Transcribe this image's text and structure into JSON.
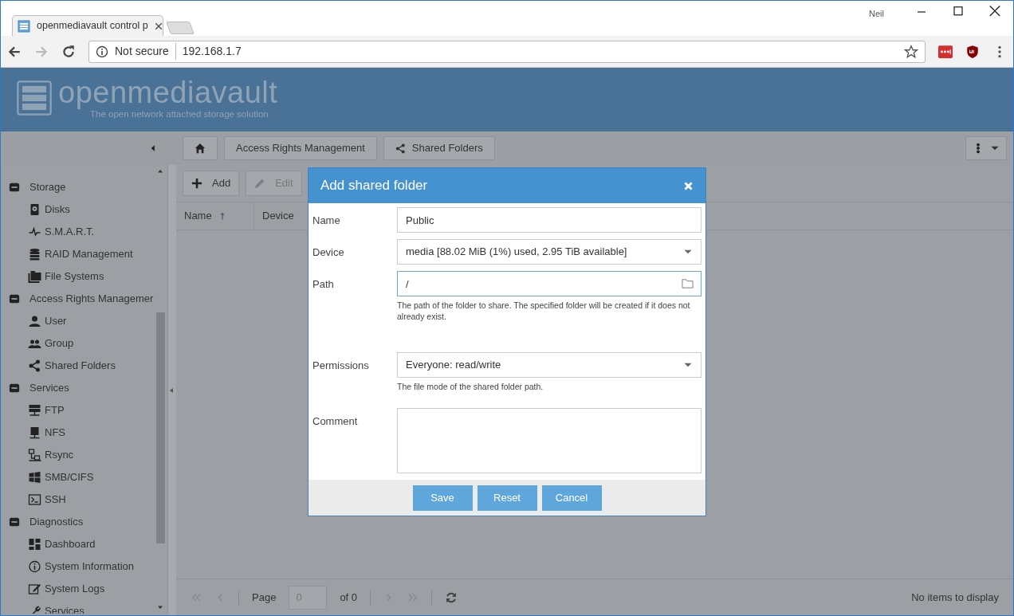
{
  "browser": {
    "tab_title": "openmediavault control p",
    "profile": "Neil",
    "security": "Not secure",
    "url": "192.168.1.7"
  },
  "header": {
    "logo_text": "openmediavault",
    "tagline": "The open network attached storage solution"
  },
  "breadcrumb": [
    {
      "label": "Access Rights Management"
    },
    {
      "label": "Shared Folders"
    }
  ],
  "sidebar": {
    "items": [
      {
        "label": "Storage",
        "expanded": true,
        "children": [
          {
            "label": "Disks"
          },
          {
            "label": "S.M.A.R.T."
          },
          {
            "label": "RAID Management"
          },
          {
            "label": "File Systems"
          }
        ]
      },
      {
        "label": "Access Rights Managemer",
        "expanded": true,
        "children": [
          {
            "label": "User"
          },
          {
            "label": "Group"
          },
          {
            "label": "Shared Folders"
          }
        ]
      },
      {
        "label": "Services",
        "expanded": true,
        "children": [
          {
            "label": "FTP"
          },
          {
            "label": "NFS"
          },
          {
            "label": "Rsync"
          },
          {
            "label": "SMB/CIFS"
          },
          {
            "label": "SSH"
          }
        ]
      },
      {
        "label": "Diagnostics",
        "expanded": true,
        "children": [
          {
            "label": "Dashboard"
          },
          {
            "label": "System Information"
          },
          {
            "label": "System Logs"
          },
          {
            "label": "Services"
          }
        ]
      }
    ]
  },
  "toolbar": [
    {
      "label": "Add",
      "disabled": false
    },
    {
      "label": "Edit",
      "disabled": true
    }
  ],
  "grid": {
    "columns": [
      {
        "label": "Name",
        "sort_ascending": true
      },
      {
        "label": "Device"
      }
    ]
  },
  "pager": {
    "page_label": "Page",
    "page_value": "0",
    "of_label": "of 0",
    "status": "No items to display"
  },
  "dialog": {
    "title": "Add shared folder",
    "fields": [
      {
        "kind": "text",
        "label": "Name",
        "value": "Public"
      },
      {
        "kind": "select",
        "label": "Device",
        "value": "media [88.02 MiB (1%) used, 2.95 TiB available]"
      },
      {
        "kind": "folder",
        "label": "Path",
        "value": "/",
        "focused": true,
        "hint": "The path of the folder to share. The specified folder will be created if it does not already exist."
      },
      {
        "kind": "select",
        "label": "Permissions",
        "value": "Everyone: read/write",
        "hint": "The file mode of the shared folder path."
      },
      {
        "kind": "textarea",
        "label": "Comment"
      }
    ],
    "buttons": [
      {
        "label": "Save"
      },
      {
        "label": "Reset"
      },
      {
        "label": "Cancel"
      }
    ]
  }
}
